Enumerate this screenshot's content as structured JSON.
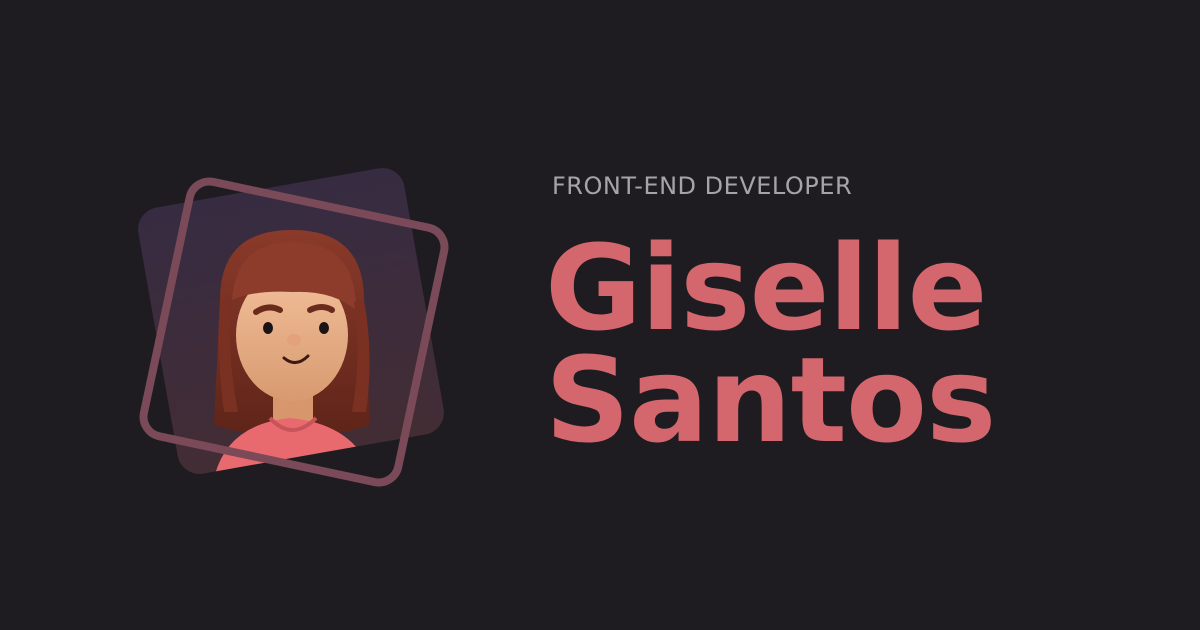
{
  "profile": {
    "role": "FRONT-END DEVELOPER",
    "first_name": "Giselle",
    "last_name": "Santos"
  },
  "colors": {
    "background": "#1e1c21",
    "accent": "#d4666d",
    "role_text": "#a6a4a9",
    "frame_fill": "#3a2c44",
    "frame_outline": "#7a4a58"
  },
  "avatar": {
    "icon": "avatar-illustration"
  }
}
